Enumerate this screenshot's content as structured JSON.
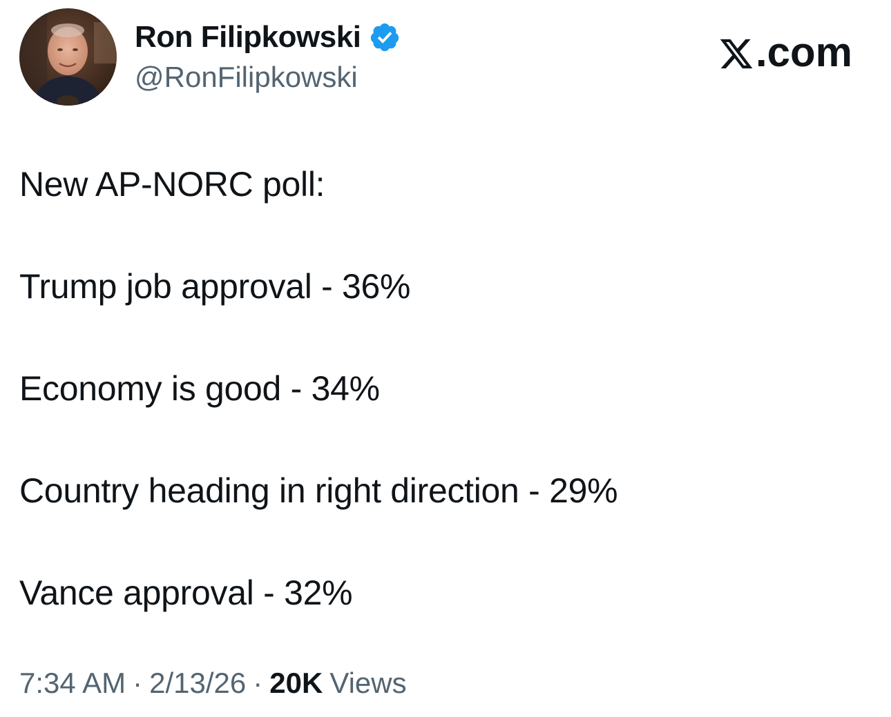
{
  "author": {
    "display_name": "Ron Filipkowski",
    "handle": "@RonFilipkowski",
    "verified": true,
    "avatar_icon": "profile-photo",
    "verified_color": "#1d9bf0"
  },
  "brand": {
    "label": ".com",
    "icon": "x-logo-icon"
  },
  "tweet": {
    "lines": [
      "New AP-NORC poll:",
      "Trump job approval - 36%",
      "Economy is good - 34%",
      "Country heading in right direction - 29%",
      "Vance approval - 32%"
    ]
  },
  "meta": {
    "time": "7:34 AM",
    "separator": "·",
    "date": "2/13/26",
    "views_count": "20K",
    "views_label": "Views"
  },
  "colors": {
    "text": "#0f1419",
    "secondary": "#536471",
    "background": "#ffffff"
  }
}
